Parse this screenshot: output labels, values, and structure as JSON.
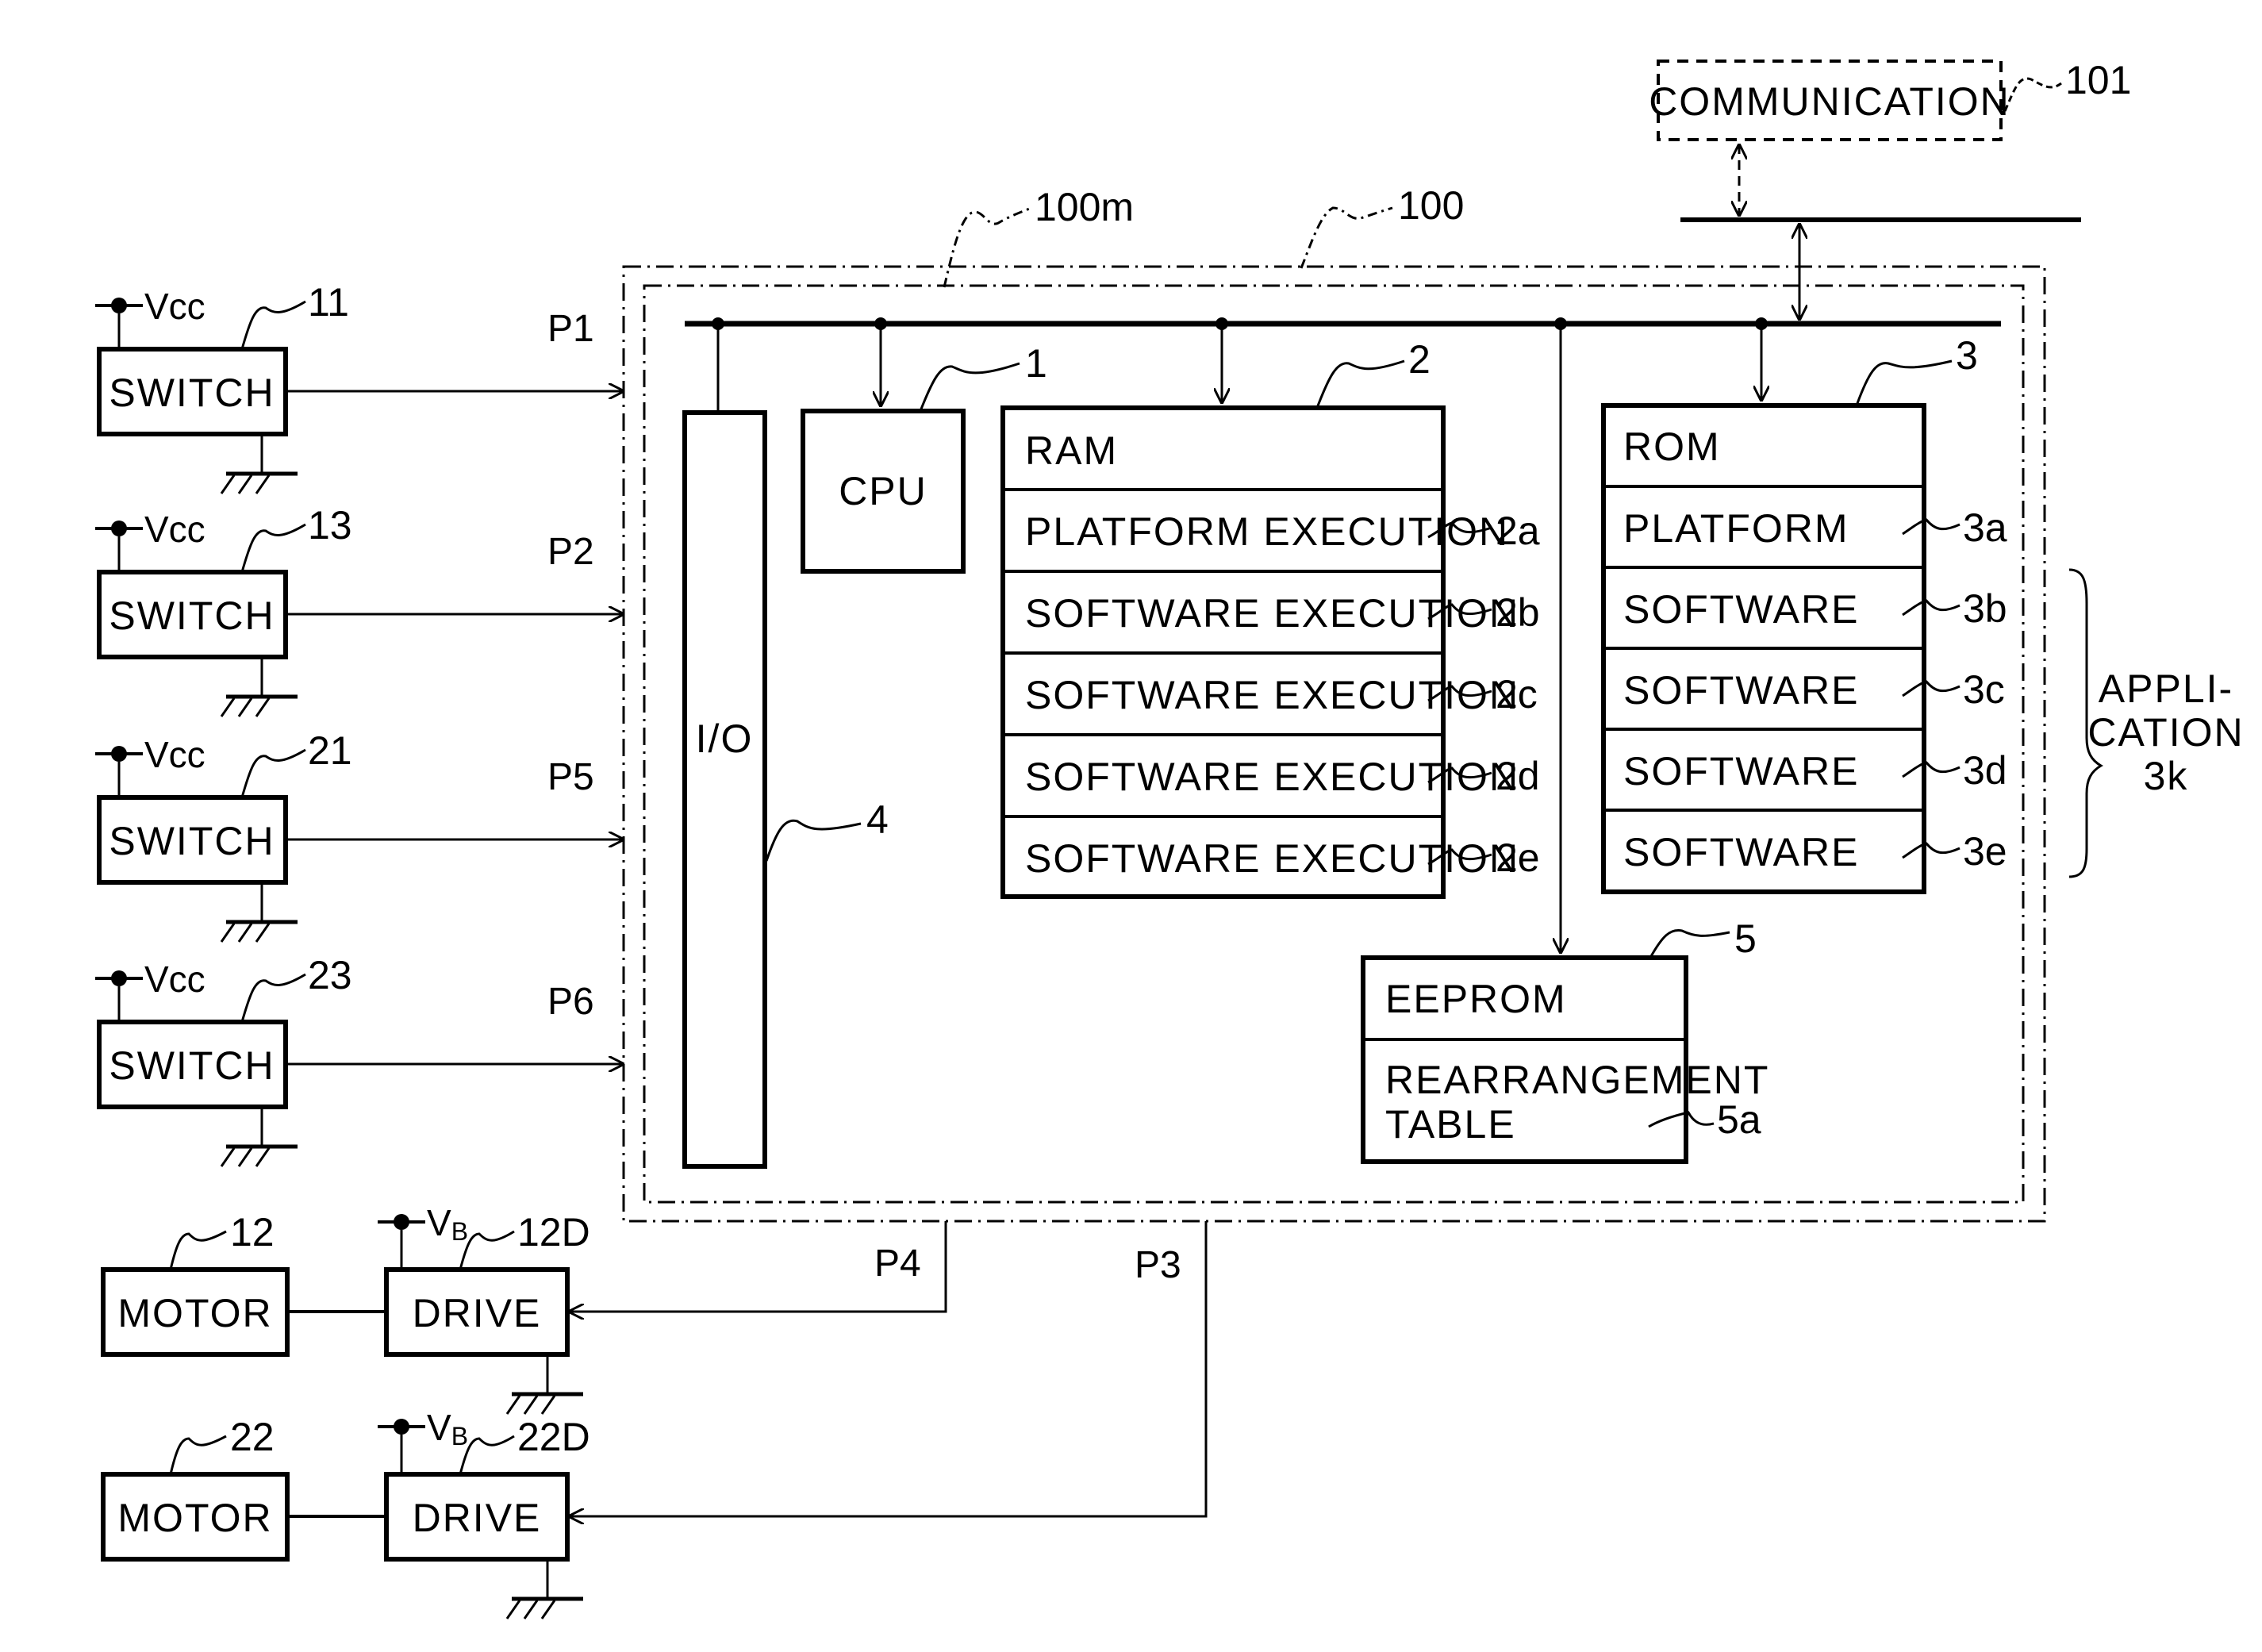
{
  "figure": {
    "communication": {
      "label": "COMMUNICATION",
      "ref": "101"
    },
    "ecu_outer": {
      "ref": "100"
    },
    "ecu_inner": {
      "ref": "100m"
    },
    "cpu": {
      "label": "CPU",
      "ref": "1"
    },
    "io": {
      "label": "I/O",
      "ref": "4"
    },
    "ram": {
      "label": "RAM",
      "ref": "2",
      "rows": [
        {
          "label": "PLATFORM EXECUTION",
          "ref": "2a"
        },
        {
          "label": "SOFTWARE EXECUTION",
          "ref": "2b"
        },
        {
          "label": "SOFTWARE EXECUTION",
          "ref": "2c"
        },
        {
          "label": "SOFTWARE EXECUTION",
          "ref": "2d"
        },
        {
          "label": "SOFTWARE EXECUTION",
          "ref": "2e"
        }
      ]
    },
    "rom": {
      "label": "ROM",
      "ref": "3",
      "rows": [
        {
          "label": "PLATFORM",
          "ref": "3a"
        },
        {
          "label": "SOFTWARE",
          "ref": "3b"
        },
        {
          "label": "SOFTWARE",
          "ref": "3c"
        },
        {
          "label": "SOFTWARE",
          "ref": "3d"
        },
        {
          "label": "SOFTWARE",
          "ref": "3e"
        }
      ]
    },
    "application": {
      "line1": "APPLI-",
      "line2": "CATION",
      "line3": "3k"
    },
    "eeprom": {
      "label": "EEPROM",
      "ref": "5",
      "table_line1": "REARRANGEMENT",
      "table_line2": "TABLE",
      "table_ref": "5a"
    },
    "switches": [
      {
        "label": "SWITCH",
        "ref": "11",
        "port": "P1",
        "supply": "Vcc"
      },
      {
        "label": "SWITCH",
        "ref": "13",
        "port": "P2",
        "supply": "Vcc"
      },
      {
        "label": "SWITCH",
        "ref": "21",
        "port": "P5",
        "supply": "Vcc"
      },
      {
        "label": "SWITCH",
        "ref": "23",
        "port": "P6",
        "supply": "Vcc"
      }
    ],
    "motors": [
      {
        "label": "MOTOR",
        "ref": "12",
        "drive_label": "DRIVE",
        "drive_ref": "12D",
        "port": "P4",
        "supply": "V",
        "supply_sub": "B"
      },
      {
        "label": "MOTOR",
        "ref": "22",
        "drive_label": "DRIVE",
        "drive_ref": "22D",
        "port": "P3",
        "supply": "V",
        "supply_sub": "B"
      }
    ]
  }
}
